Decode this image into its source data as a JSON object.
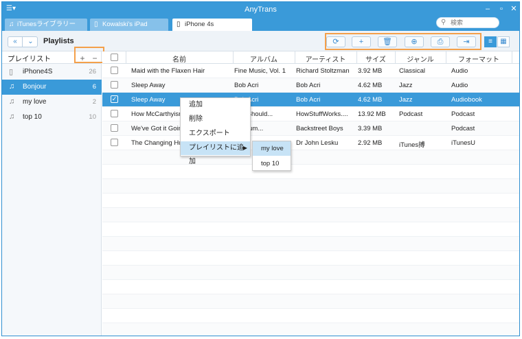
{
  "app": {
    "title": "AnyTrans"
  },
  "search": {
    "placeholder": "検索"
  },
  "tabs": [
    {
      "label": "iTunesライブラリー",
      "icon": "music-note-icon"
    },
    {
      "label": "Kowalski's iPad",
      "icon": "tablet-icon"
    },
    {
      "label": "iPhone 4s",
      "icon": "phone-icon",
      "active": true
    }
  ],
  "toolbar": {
    "breadcrumb": "Playlists",
    "actions": [
      "refresh-icon",
      "add-icon",
      "delete-icon",
      "import-icon",
      "export-to-pc-icon",
      "export-to-device-icon"
    ],
    "views": [
      "list-view-icon",
      "grid-view-icon"
    ]
  },
  "sidebar": {
    "header": "プレイリスト",
    "add_label": "+",
    "remove_label": "−",
    "items": [
      {
        "name": "iPhone4S",
        "count": "26",
        "icon": "phone-icon"
      },
      {
        "name": "Bonjour",
        "count": "6",
        "icon": "playlist-icon",
        "selected": true
      },
      {
        "name": "my love",
        "count": "2",
        "icon": "playlist-icon"
      },
      {
        "name": "top 10",
        "count": "10",
        "icon": "playlist-icon"
      }
    ]
  },
  "table": {
    "columns": [
      "名前",
      "アルバム",
      "アーティスト",
      "サイズ",
      "ジャンル",
      "フォーマット"
    ],
    "rows": [
      {
        "name": "Maid with the Flaxen Hair",
        "album": "Fine Music, Vol. 1",
        "artist": "Richard Stoltzman",
        "size": "3.92 MB",
        "genre": "Classical",
        "format": "Audio"
      },
      {
        "name": "Sleep Away",
        "album": "Bob Acri",
        "artist": "Bob Acri",
        "size": "4.62 MB",
        "genre": "Jazz",
        "format": "Audio"
      },
      {
        "name": "Sleep Away",
        "album": "Bob Acri",
        "artist": "Bob Acri",
        "size": "4.62 MB",
        "genre": "Jazz",
        "format": "Audiobook",
        "selected": true
      },
      {
        "name": "How McCarthyism",
        "album": "You Should...",
        "artist": "HowStuffWorks....",
        "size": "13.92 MB",
        "genre": "Podcast",
        "format": "Podcast"
      },
      {
        "name": "We've Got it Going",
        "album": "n Album...",
        "artist": "Backstreet Boys",
        "size": "3.39 MB",
        "genre": "",
        "format": "Podcast"
      },
      {
        "name": "The Changing Hur",
        "album": "",
        "artist": "Dr John Lesku",
        "size": "2.92 MB",
        "genre": "iTunes搏",
        "format": "iTunesU"
      }
    ]
  },
  "context_menu": {
    "items": [
      "追加",
      "削除",
      "エクスポート",
      "プレイリストに追加"
    ],
    "submenu": [
      "my love",
      "top 10"
    ]
  }
}
